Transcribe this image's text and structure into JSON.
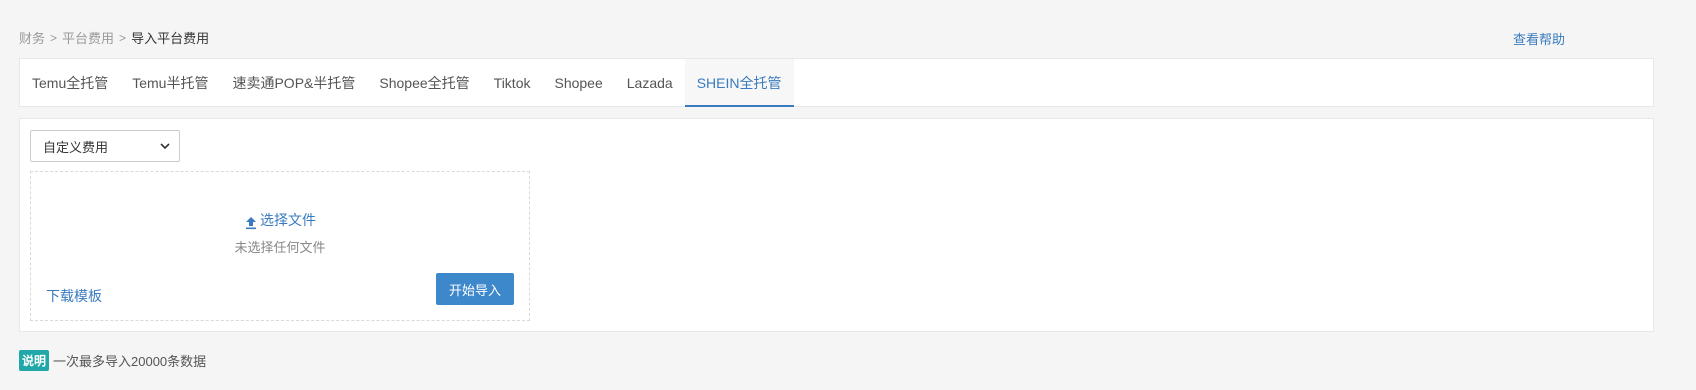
{
  "breadcrumb": {
    "items": [
      "财务",
      "平台费用"
    ],
    "current": "导入平台费用",
    "separator": ">"
  },
  "help_link": "查看帮助",
  "tabs": [
    {
      "label": "Temu全托管",
      "active": false
    },
    {
      "label": "Temu半托管",
      "active": false
    },
    {
      "label": "速卖通POP&半托管",
      "active": false
    },
    {
      "label": "Shopee全托管",
      "active": false
    },
    {
      "label": "Tiktok",
      "active": false
    },
    {
      "label": "Shopee",
      "active": false
    },
    {
      "label": "Lazada",
      "active": false
    },
    {
      "label": "SHEIN全托管",
      "active": true
    }
  ],
  "fee_select": {
    "selected": "自定义费用"
  },
  "upload": {
    "choose_label": "选择文件",
    "upload_icon": "upload-arrow-icon",
    "no_file_text": "未选择任何文件",
    "download_template": "下载模板",
    "start_button": "开始导入"
  },
  "note": {
    "badge": "说明",
    "text": "一次最多导入20000条数据"
  },
  "colors": {
    "accent": "#3a7bbf",
    "button": "#3d87cb",
    "badge": "#20a8a8",
    "background": "#f5f5f5"
  }
}
